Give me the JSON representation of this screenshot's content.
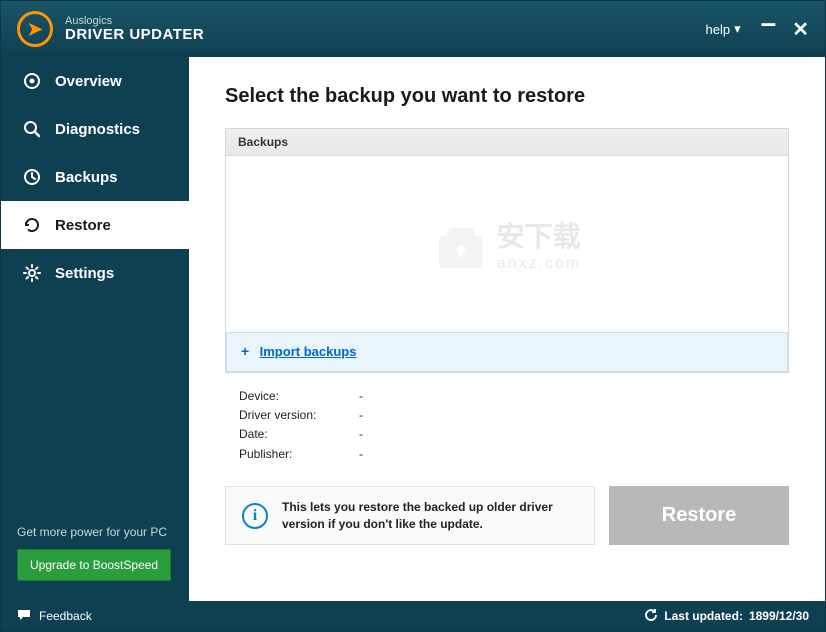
{
  "brand": {
    "company": "Auslogics",
    "product": "DRIVER UPDATER"
  },
  "titlebar": {
    "help": "help"
  },
  "sidebar": {
    "items": [
      {
        "label": "Overview",
        "icon": "target-icon"
      },
      {
        "label": "Diagnostics",
        "icon": "magnify-icon"
      },
      {
        "label": "Backups",
        "icon": "clock-icon"
      },
      {
        "label": "Restore",
        "icon": "undo-icon"
      },
      {
        "label": "Settings",
        "icon": "gear-icon"
      }
    ],
    "active_index": 3,
    "promo_text": "Get more power for your PC",
    "upgrade_label": "Upgrade to BoostSpeed"
  },
  "main": {
    "title": "Select the backup you want to restore",
    "backups_header": "Backups",
    "import_label": "Import backups",
    "details": {
      "device_label": "Device:",
      "device_value": "-",
      "driver_version_label": "Driver version:",
      "driver_version_value": "-",
      "date_label": "Date:",
      "date_value": "-",
      "publisher_label": "Publisher:",
      "publisher_value": "-"
    },
    "info_text": "This lets you restore the backed up older driver version if you don't like the update.",
    "restore_button": "Restore"
  },
  "statusbar": {
    "feedback": "Feedback",
    "last_updated_label": "Last updated:",
    "last_updated_value": "1899/12/30"
  },
  "watermark": {
    "cn": "安下载",
    "en": "anxz.com"
  }
}
